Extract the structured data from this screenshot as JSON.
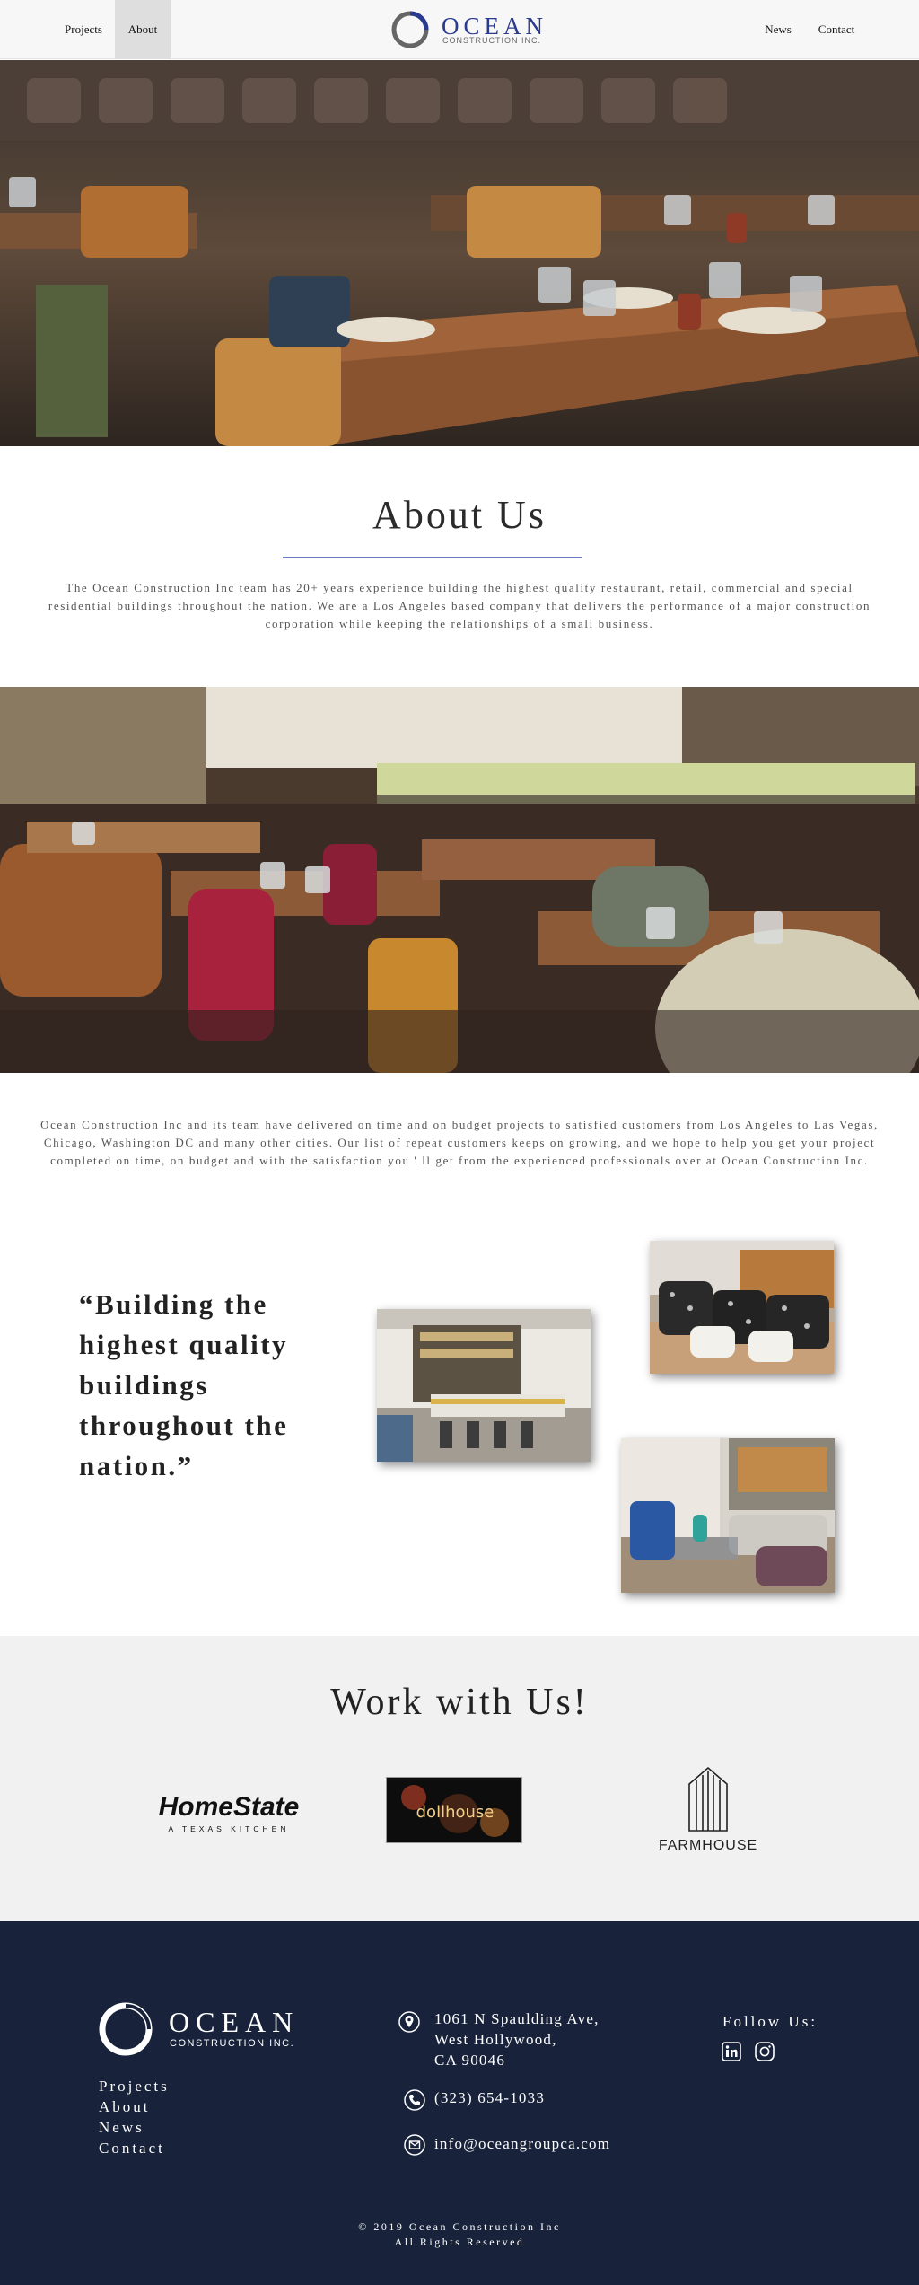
{
  "nav": {
    "left": [
      {
        "label": "Projects"
      },
      {
        "label": "About"
      }
    ],
    "right": [
      {
        "label": "News"
      },
      {
        "label": "Contact"
      }
    ],
    "logo": {
      "word": "OCEAN",
      "sub": "CONSTRUCTION INC."
    }
  },
  "about": {
    "title": "About Us",
    "text": "The Ocean Construction Inc team has 20+ years experience building the highest quality restaurant, retail, commercial and special residential buildings throughout the nation. We are a Los Angeles based company that delivers the performance of a major construction corporation while keeping the relationships of a small business."
  },
  "intro_text": "Ocean Construction Inc and its team have delivered on time and on budget projects to satisfied customers from Los Angeles to Las Vegas, Chicago, Washington DC and many other cities. Our list of repeat customers keeps on growing, and we hope to help you get your project completed on time, on budget and with the satisfaction you ' ll get from the experienced professionals over at Ocean Construction Inc.",
  "quote": "“Building the highest quality buildings throughout the nation.”",
  "work": {
    "title": "Work with Us!",
    "brands": [
      {
        "name": "HomeState",
        "tagline": "A TEXAS KITCHEN"
      },
      {
        "name": "dollhouse"
      },
      {
        "name": "FARMHOUSE"
      }
    ]
  },
  "footer": {
    "logo": {
      "word": "OCEAN",
      "sub": "CONSTRUCTION INC."
    },
    "links": [
      {
        "label": "Projects"
      },
      {
        "label": "About"
      },
      {
        "label": "News"
      },
      {
        "label": "Contact"
      }
    ],
    "address": [
      "1061 N Spaulding Ave,",
      "West Hollywood,",
      "CA 90046"
    ],
    "phone": "(323) 654-1033",
    "email": "info@oceangroupca.com",
    "follow": "Follow Us:",
    "copyright": [
      "© 2019 Ocean Construction Inc",
      "All Rights Reserved"
    ]
  },
  "colors": {
    "navy": "#18233b",
    "accent": "#6f78c7",
    "logo_blue": "#2a3a8c"
  },
  "icons": [
    "location-icon",
    "phone-icon",
    "mail-icon",
    "linkedin-icon",
    "instagram-icon"
  ]
}
